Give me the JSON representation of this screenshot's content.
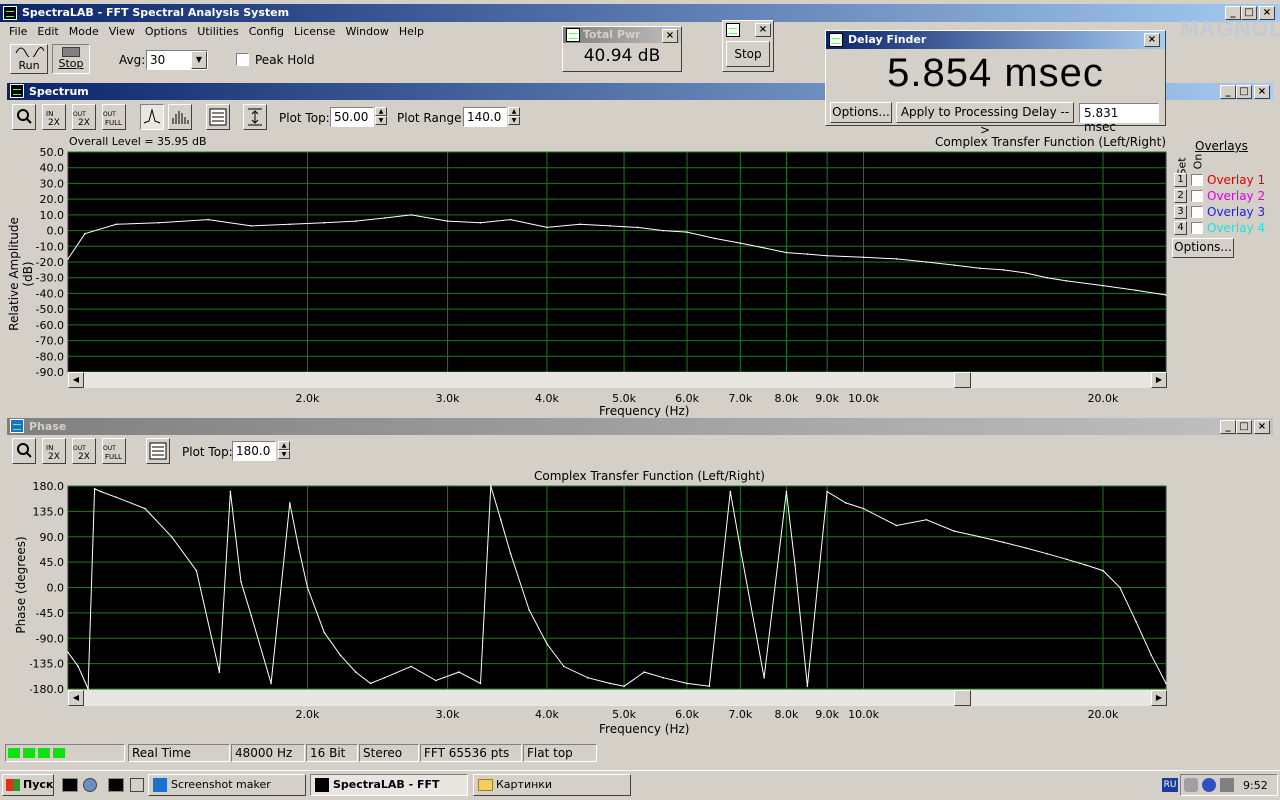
{
  "app": {
    "title": "SpectraLAB - FFT Spectral Analysis System",
    "watermark": "MAGNOLIA"
  },
  "menu": [
    "File",
    "Edit",
    "Mode",
    "View",
    "Options",
    "Utilities",
    "Config",
    "License",
    "Window",
    "Help"
  ],
  "toolbar": {
    "run_label": "Run",
    "stop_label": "Stop",
    "avg_label": "Avg:",
    "avg_value": "30",
    "peak_hold_label": "Peak Hold"
  },
  "total_pwr": {
    "title": "Total Pwr",
    "value": "40.94 dB"
  },
  "stop_window": {
    "button_label": "Stop"
  },
  "delay_finder": {
    "title": "Delay Finder",
    "value": "5.854 msec",
    "options_label": "Options...",
    "apply_label": "Apply to Processing Delay -->",
    "delay_value": "5.831 msec"
  },
  "spectrum": {
    "title": "Spectrum",
    "plot_top_label": "Plot Top:",
    "plot_top_value": "50.00",
    "plot_range_label": "Plot Range:",
    "plot_range_value": "140.0",
    "overall_level": "Overall Level = 35.95 dB",
    "chart_title": "Complex Transfer Function (Left/Right)",
    "overlays_label": "Overlays",
    "set_label": "Set",
    "on_label": "On",
    "overlays": [
      {
        "num": "1",
        "label": "Overlay 1",
        "color": "#e00000"
      },
      {
        "num": "2",
        "label": "Overlay 2",
        "color": "#e000e0"
      },
      {
        "num": "3",
        "label": "Overlay 3",
        "color": "#2020e0"
      },
      {
        "num": "4",
        "label": "Overlay 4",
        "color": "#20e0e0"
      }
    ],
    "overlay_options_label": "Options..."
  },
  "phase": {
    "title": "Phase",
    "plot_top_label": "Plot Top:",
    "plot_top_value": "180.0",
    "chart_title": "Complex Transfer Function (Left/Right)"
  },
  "chart_data": [
    {
      "type": "line",
      "title": "Complex Transfer Function (Left/Right)",
      "xlabel": "Frequency (Hz)",
      "ylabel": "Relative Amplitude (dB)",
      "ylim": [
        -90,
        50
      ],
      "x_scale": "log",
      "xlim": [
        1000,
        24000
      ],
      "x_ticks": [
        2000,
        3000,
        4000,
        5000,
        6000,
        7000,
        8000,
        9000,
        10000,
        20000
      ],
      "x_tick_labels": [
        "2.0k",
        "3.0k",
        "4.0k",
        "5.0k",
        "6.0k",
        "7.0k",
        "8.0k",
        "9.0k",
        "10.0k",
        "20.0k"
      ],
      "y_ticks": [
        50,
        40,
        30,
        20,
        10,
        0,
        -10,
        -20,
        -30,
        -40,
        -50,
        -60,
        -70,
        -80,
        -90
      ],
      "y_tick_labels": [
        "50.0",
        "40.0",
        "30.0",
        "20.0",
        "10.0",
        "0.0",
        "-10.0",
        "-20.0",
        "-30.0",
        "-40.0",
        "-50.0",
        "-60.0",
        "-70.0",
        "-80.0",
        "-90.0"
      ],
      "grid": true,
      "series": [
        {
          "x": [
            1000,
            1050,
            1150,
            1300,
            1500,
            1700,
            1900,
            2100,
            2300,
            2500,
            2700,
            3000,
            3300,
            3600,
            4000,
            4400,
            4800,
            5200,
            5600,
            6000,
            6500,
            7000,
            7500,
            8000,
            8500,
            9000,
            10000,
            11000,
            12000,
            13000,
            14000,
            15000,
            16000,
            17000,
            18000,
            20000,
            22000,
            24000
          ],
          "y": [
            -18,
            -2,
            4,
            5,
            7,
            3,
            4,
            5,
            6,
            8,
            10,
            6,
            5,
            7,
            2,
            4,
            3,
            2,
            0,
            -1,
            -5,
            -8,
            -11,
            -14,
            -15,
            -16,
            -17,
            -18,
            -20,
            -22,
            -24,
            -25,
            -27,
            -30,
            -32,
            -35,
            -38,
            -41
          ]
        }
      ]
    },
    {
      "type": "line",
      "title": "Complex Transfer Function (Left/Right)",
      "xlabel": "Frequency (Hz)",
      "ylabel": "Phase (degrees)",
      "ylim": [
        -180,
        180
      ],
      "x_scale": "log",
      "xlim": [
        1000,
        24000
      ],
      "x_ticks": [
        2000,
        3000,
        4000,
        5000,
        6000,
        7000,
        8000,
        9000,
        10000,
        20000
      ],
      "x_tick_labels": [
        "2.0k",
        "3.0k",
        "4.0k",
        "5.0k",
        "6.0k",
        "7.0k",
        "8.0k",
        "9.0k",
        "10.0k",
        "20.0k"
      ],
      "y_ticks": [
        180,
        135,
        90,
        45,
        0,
        -45,
        -90,
        -135,
        -180
      ],
      "y_tick_labels": [
        "180.0",
        "135.0",
        "90.0",
        "45.0",
        "0.0",
        "-45.0",
        "-90.0",
        "-135.0",
        "-180.0"
      ],
      "grid": true,
      "series": [
        {
          "x": [
            1000,
            1030,
            1060,
            1080,
            1100,
            1150,
            1250,
            1350,
            1450,
            1550,
            1600,
            1650,
            1700,
            1800,
            1900,
            1950,
            2000,
            2100,
            2200,
            2300,
            2400,
            2500,
            2700,
            2900,
            3100,
            3300,
            3400,
            3500,
            3600,
            3800,
            4000,
            4200,
            4500,
            4800,
            5000,
            5300,
            5600,
            6000,
            6400,
            6800,
            7000,
            7500,
            8000,
            8200,
            8500,
            9000,
            9500,
            10000,
            11000,
            12000,
            13000,
            14000,
            15000,
            16000,
            17000,
            18000,
            19000,
            20000,
            21000,
            22000,
            23000,
            24000
          ],
          "y": [
            -115,
            -140,
            -180,
            175,
            170,
            160,
            140,
            90,
            30,
            -150,
            170,
            10,
            -50,
            -170,
            150,
            70,
            0,
            -80,
            -120,
            -150,
            -170,
            -160,
            -140,
            -165,
            -150,
            -170,
            180,
            120,
            60,
            -40,
            -100,
            -140,
            -160,
            -170,
            -175,
            -150,
            -160,
            -170,
            -175,
            170,
            70,
            -160,
            170,
            40,
            -175,
            170,
            150,
            140,
            110,
            120,
            100,
            90,
            80,
            70,
            60,
            50,
            40,
            30,
            0,
            -60,
            -120,
            -170
          ]
        }
      ]
    }
  ],
  "status": {
    "mode": "Real Time",
    "sample_rate": "48000 Hz",
    "bits": "16 Bit",
    "channels": "Stereo",
    "fft": "FFT 65536 pts",
    "window": "Flat top"
  },
  "taskbar": {
    "start_label": "Пуск",
    "tasks": [
      "Screenshot maker",
      "SpectraLAB - FFT Spe...",
      "Картинки"
    ],
    "lang": "RU",
    "clock": "9:52"
  }
}
